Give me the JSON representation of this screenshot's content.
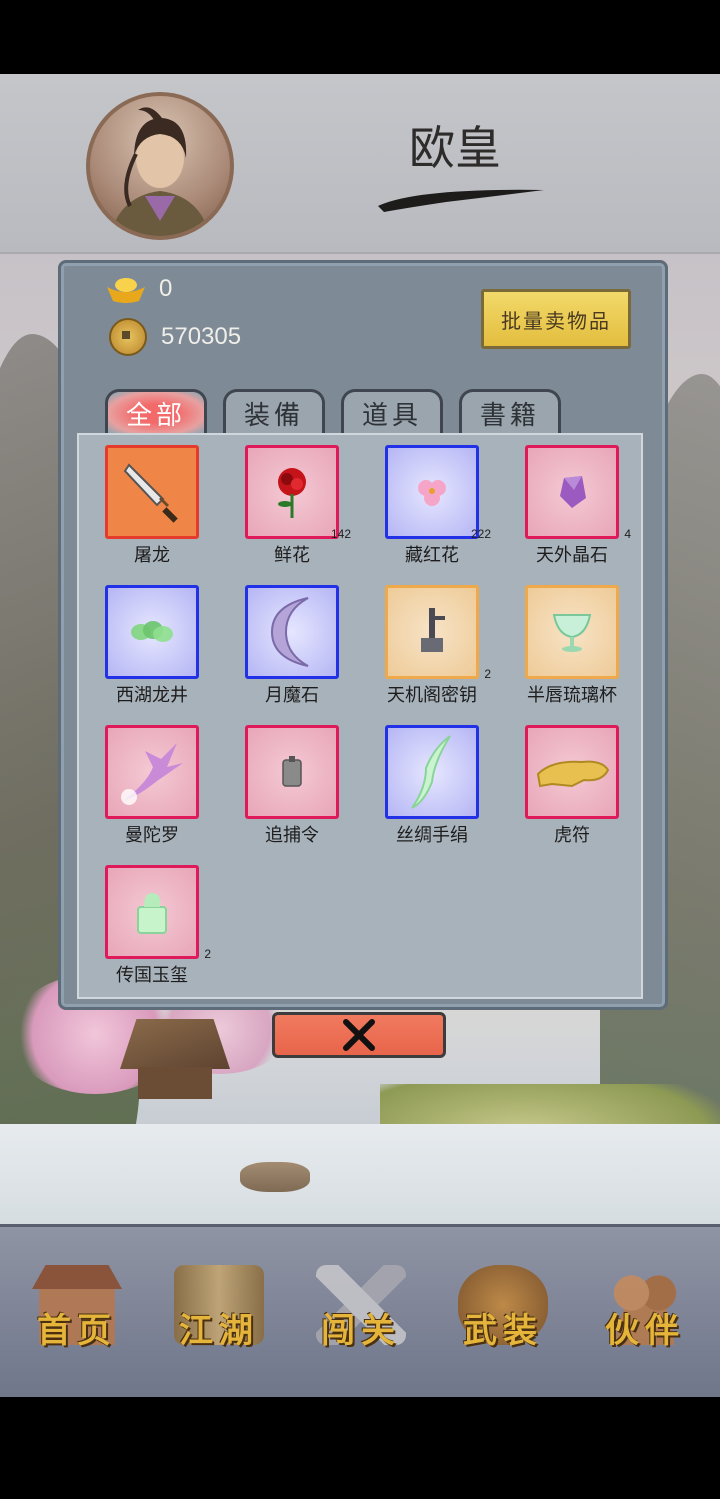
{
  "player": {
    "name": "欧皇"
  },
  "currency": {
    "ingot": "0",
    "coins": "570305"
  },
  "sell_button": "批量卖物品",
  "tabs": [
    {
      "label": "全部",
      "active": true
    },
    {
      "label": "装備",
      "active": false
    },
    {
      "label": "道具",
      "active": false
    },
    {
      "label": "書籍",
      "active": false
    }
  ],
  "items": [
    {
      "name": "屠龙",
      "count": "",
      "rarity": "orange",
      "icon": "broadsword-icon"
    },
    {
      "name": "鲜花",
      "count": "142",
      "rarity": "red",
      "icon": "rose-icon"
    },
    {
      "name": "藏红花",
      "count": "222",
      "rarity": "blue",
      "icon": "saffron-flower-icon"
    },
    {
      "name": "天外晶石",
      "count": "4",
      "rarity": "red",
      "icon": "crystal-icon"
    },
    {
      "name": "西湖龙井",
      "count": "",
      "rarity": "blue",
      "icon": "tea-leaves-icon"
    },
    {
      "name": "月魔石",
      "count": "",
      "rarity": "blue",
      "icon": "moon-stone-icon"
    },
    {
      "name": "天机阁密钥",
      "count": "2",
      "rarity": "gold",
      "icon": "key-icon"
    },
    {
      "name": "半唇琉璃杯",
      "count": "",
      "rarity": "gold",
      "icon": "glass-cup-icon"
    },
    {
      "name": "曼陀罗",
      "count": "",
      "rarity": "red",
      "icon": "datura-flower-icon"
    },
    {
      "name": "追捕令",
      "count": "",
      "rarity": "red",
      "icon": "warrant-token-icon"
    },
    {
      "name": "丝绸手绢",
      "count": "",
      "rarity": "blue",
      "icon": "silk-handkerchief-icon"
    },
    {
      "name": "虎符",
      "count": "",
      "rarity": "red",
      "icon": "tiger-tally-icon"
    },
    {
      "name": "传国玉玺",
      "count": "2",
      "rarity": "red",
      "icon": "jade-seal-icon"
    }
  ],
  "nav": [
    {
      "label": "首页",
      "icon": "house-icon"
    },
    {
      "label": "江湖",
      "icon": "scroll-icon"
    },
    {
      "label": "闯关",
      "icon": "crossed-swords-icon"
    },
    {
      "label": "武装",
      "icon": "armor-icon"
    },
    {
      "label": "伙伴",
      "icon": "partners-icon"
    }
  ],
  "colors": {
    "rarity_red": "#e0195a",
    "rarity_blue": "#2230e8",
    "rarity_gold": "#f0a94a",
    "rarity_orange": "#e63a2a",
    "sell_button": "#f2d96a",
    "close_button": "#f07a5f",
    "nav_text": "#e4b53a"
  }
}
